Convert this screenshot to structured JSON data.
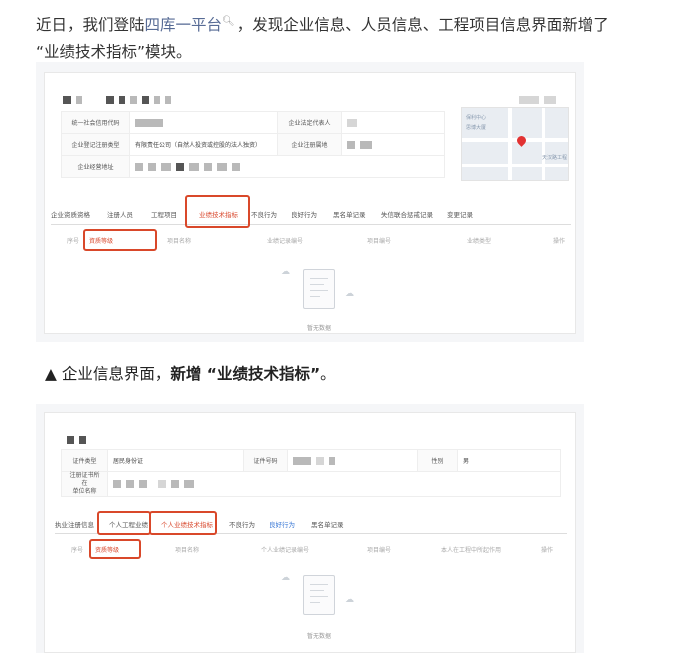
{
  "article": {
    "para_prefix": "近日，我们登陆",
    "platform_link": "四库一平台",
    "search_icon": "magnifier-icon",
    "para_suffix_line1": "，发现企业信息、人员信息、工程项目信息界面新增了",
    "para_line2": "“业绩技术指标”模块。",
    "caption_arrow": "▲",
    "caption_text": " 企业信息界面，",
    "caption_bold": "新增 “业绩技术指标”",
    "caption_end": "。"
  },
  "company": {
    "row1_label": "统一社会信用代码",
    "legal_rep_label": "企业法定代表人",
    "row2_label": "企业登记注册类型",
    "registration_type": "有限责任公司（自然人投资或控股的法人独资）",
    "region_label": "企业注册属地",
    "address_label": "企业经营地址",
    "map_labels": [
      "保利中心",
      "思博大厦",
      "天汉路工程"
    ]
  },
  "company_tabs": [
    "企业资质资格",
    "注册人员",
    "工程项目",
    "业绩技术指标",
    "不良行为",
    "良好行为",
    "黑名单记录",
    "失信联合惩戒记录",
    "变更记录"
  ],
  "company_table_headers": [
    "序号",
    "資质等级",
    "项目名称",
    "业绩记录编号",
    "项目编号",
    "业绩类型",
    "操作"
  ],
  "empty_text": "暂无数据",
  "person": {
    "id_type_label": "证件类型",
    "id_type_value": "居民身份证",
    "id_number_label": "证件号码",
    "gender_label": "性别",
    "gender_value": "男",
    "reg_unit_label_1": "注册证书所在",
    "reg_unit_label_2": "单位名称"
  },
  "person_tabs": [
    "执业注册信息",
    "个人工程业绩",
    "个人业绩技术指标",
    "不良行为",
    "良好行为",
    "黑名单记录"
  ],
  "person_table_headers": [
    "序号",
    "资质等级",
    "项目名称",
    "个人业绩记录编号",
    "项目编号",
    "本人在工程中所起作用",
    "操作"
  ],
  "colors": {
    "highlight_red": "#d9482a",
    "link_blue": "#576b95",
    "active_blue": "#3a78d6"
  }
}
